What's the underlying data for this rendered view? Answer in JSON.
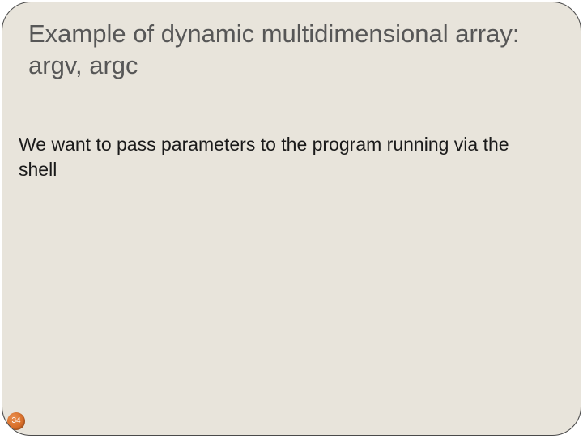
{
  "slide": {
    "title": "Example of dynamic multidimensional array: argv, argc",
    "body": "We want to pass parameters to the program running via the shell",
    "page_number": "34"
  }
}
